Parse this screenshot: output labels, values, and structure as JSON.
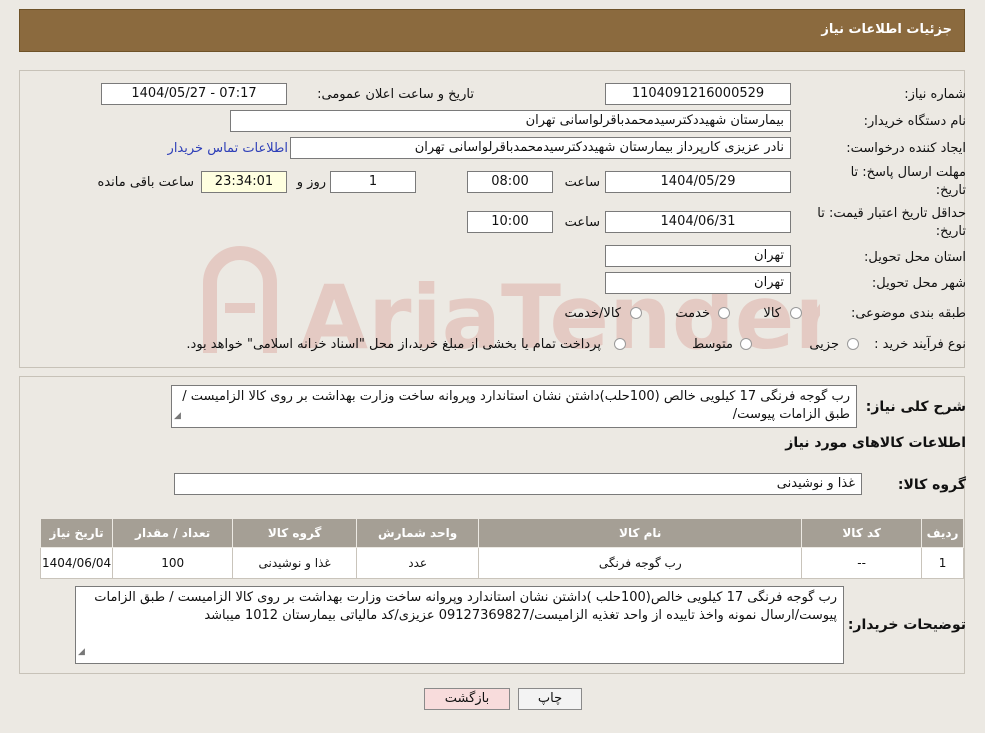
{
  "header": {
    "title": "جزئیات اطلاعات نیاز"
  },
  "form": {
    "need_number_label": "شماره نیاز:",
    "need_number": "1104091216000529",
    "announce_label": "تاریخ و ساعت اعلان عمومی:",
    "announce_value": "1404/05/27 - 07:17",
    "buyer_org_label": "نام دستگاه خریدار:",
    "buyer_org": "بیمارستان شهیددکترسیدمحمدباقرلواسانی تهران",
    "creator_label": "ایجاد کننده درخواست:",
    "creator": "نادر  عزیزی کارپرداز بیمارستان شهیددکترسیدمحمدباقرلواسانی تهران",
    "contact_link": "اطلاعات تماس خریدار",
    "deadline_label_1": "مهلت ارسال پاسخ: تا",
    "deadline_label_2": "تاریخ:",
    "deadline_date": "1404/05/29",
    "time_label": "ساعت",
    "deadline_time": "08:00",
    "days_value": "1",
    "days_label": "روز و",
    "remaining_value": "23:34:01",
    "remaining_label": "ساعت باقی مانده",
    "validity_label_1": "حداقل تاریخ اعتبار قیمت: تا",
    "validity_label_2": "تاریخ:",
    "validity_date": "1404/06/31",
    "validity_time_label": "ساعت",
    "validity_time": "10:00",
    "province_label": "استان محل تحویل:",
    "province": "تهران",
    "city_label": "شهر محل تحویل:",
    "city": "تهران",
    "category_label": "طبقه بندی موضوعی:",
    "category_options": [
      "کالا",
      "خدمت",
      "کالا/خدمت"
    ],
    "process_label": "نوع فرآیند خرید :",
    "process_options": [
      "جزیی",
      "متوسط"
    ],
    "process_note": "پرداخت تمام یا بخشی از مبلغ خرید،از محل \"اسناد خزانه اسلامی\" خواهد بود."
  },
  "summary": {
    "label": "شرح کلی نیاز:",
    "text": "رب گوجه فرنگی 17 کیلویی خالص  (100حلب)داشتن نشان استاندارد وپروانه ساخت وزارت بهداشت بر روی کالا الزامیست /طبق الزامات پیوست/",
    "goods_heading": "اطلاعات کالاهای مورد نیاز",
    "group_label": "گروه کالا:",
    "group_value": "غذا و نوشیدنی"
  },
  "table": {
    "headers": [
      "ردیف",
      "کد کالا",
      "نام کالا",
      "واحد شمارش",
      "گروه کالا",
      "تعداد / مقدار",
      "تاریخ نیاز"
    ],
    "rows": [
      [
        "1",
        "--",
        "رب گوجه فرنگی",
        "عدد",
        "غذا و نوشیدنی",
        "100",
        "1404/06/04"
      ]
    ]
  },
  "buyer_notes": {
    "label": "توضیحات خریدار:",
    "text": "رب گوجه فرنگی 17 کیلویی خالص(100حلب )داشتن نشان استاندارد وپروانه ساخت وزارت بهداشت بر روی کالا الزامیست / طبق الزامات پیوست/ارسال نمونه واخذ تاییده از واحد تغذیه الزامیست/09127369827 عزیزی/کد مالیاتی بیمارستان 1012 میباشد"
  },
  "buttons": {
    "print": "چاپ",
    "back": "بازگشت"
  },
  "watermark": {
    "text": "AriaTender.neT"
  },
  "colors": {
    "header": "#8b6a3e",
    "table_header": "#a59f95",
    "back_button": "#f8dcdc",
    "link": "#2e3fb8",
    "watermark": "#c0392b"
  }
}
